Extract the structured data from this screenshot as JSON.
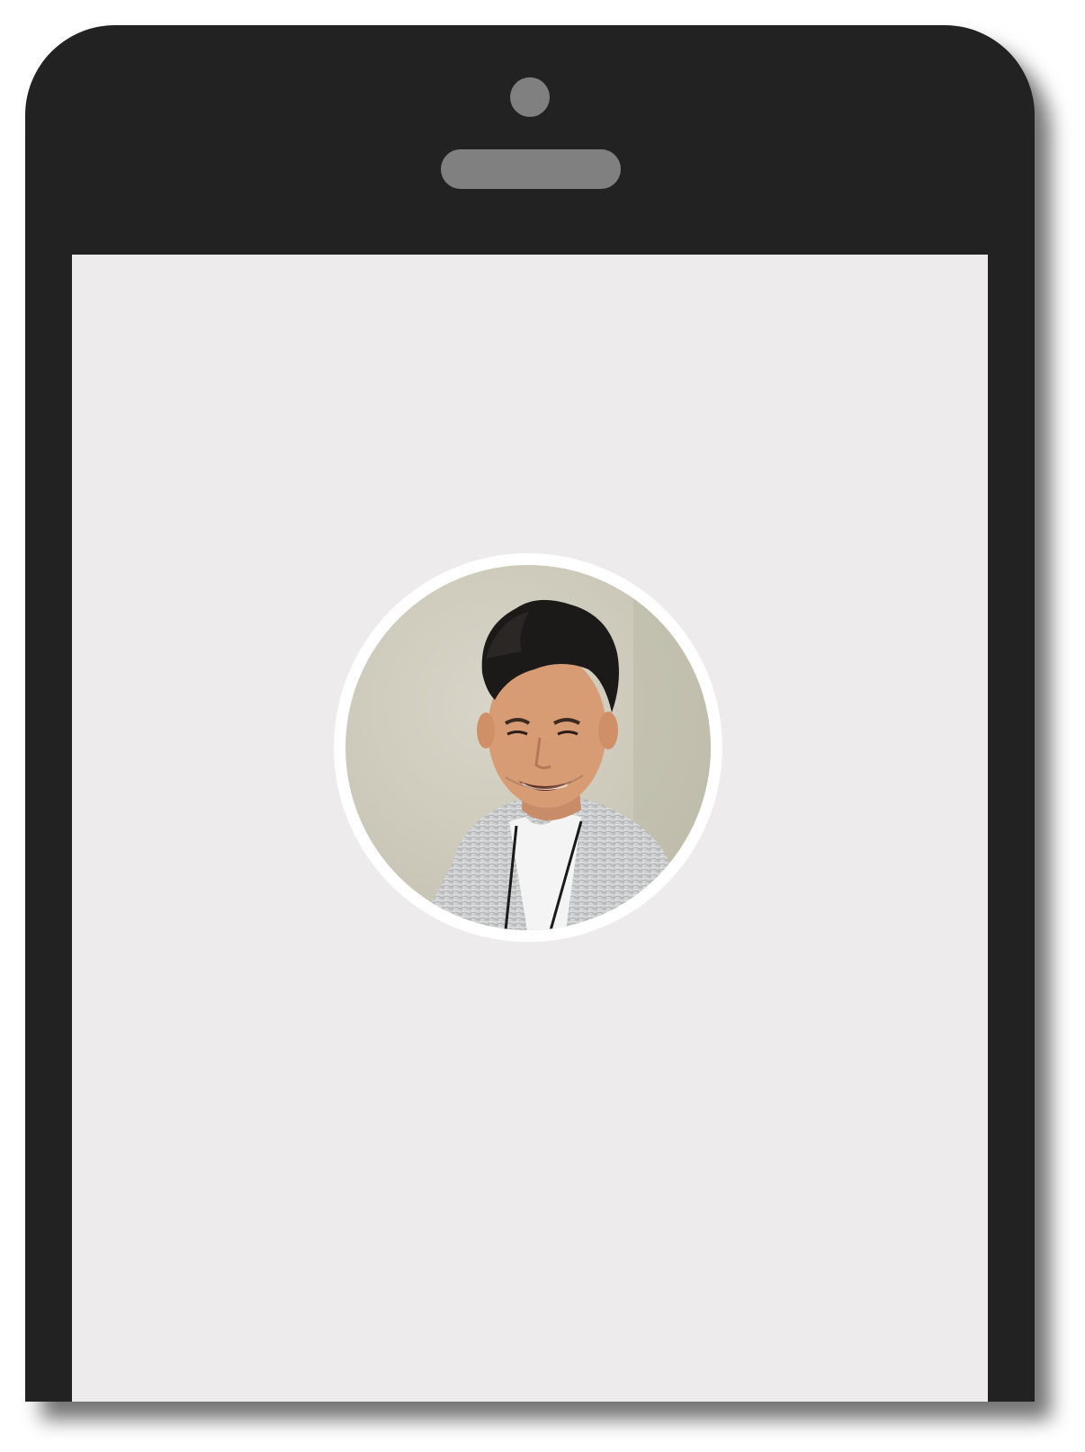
{
  "colors": {
    "device_body": "#222222",
    "device_detail": "#808080",
    "screen_background": "#edebec",
    "avatar_ring": "#ffffff"
  },
  "device": {
    "camera_icon": "circle",
    "speaker_icon": "rounded-bar"
  },
  "profile": {
    "avatar_icon": "person-photo"
  }
}
